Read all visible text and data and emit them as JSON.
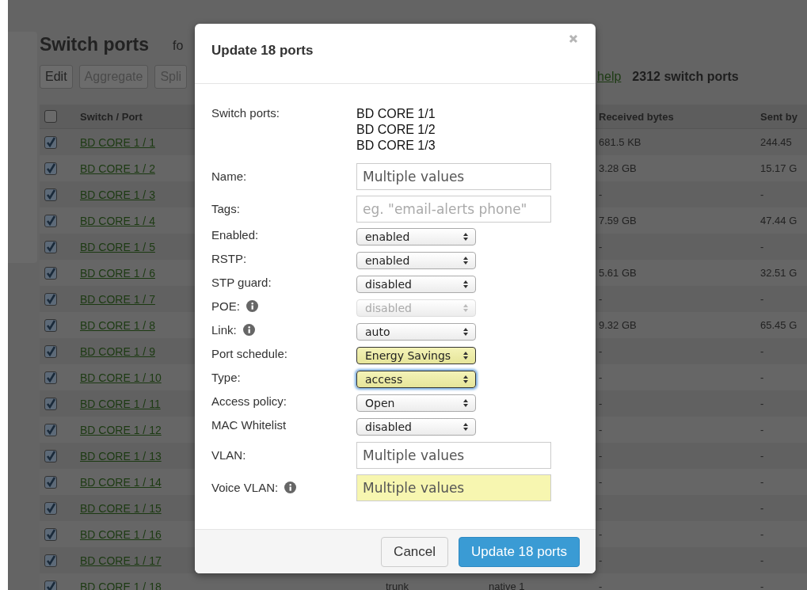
{
  "page": {
    "title": "Switch ports",
    "title_suffix": "fo",
    "help_link": "help",
    "count": "2312 switch ports",
    "toolbar": [
      {
        "label": "Edit",
        "disabled": false
      },
      {
        "label": "Aggregate",
        "disabled": true
      },
      {
        "label": "Spli",
        "disabled": true
      }
    ]
  },
  "table": {
    "select_all": {
      "checked": false
    },
    "columns": {
      "port": "Switch / Port",
      "received": "Received bytes",
      "sent": "Sent by"
    },
    "rows": [
      {
        "checked": true,
        "port": "BD CORE 1 / 1",
        "received": "681.5 KB",
        "sent": "244.45"
      },
      {
        "checked": true,
        "port": "BD CORE 1 / 2",
        "received": "3.28 GB",
        "sent": "15.17 G"
      },
      {
        "checked": true,
        "port": "BD CORE 1 / 3",
        "received": "-",
        "sent": "-"
      },
      {
        "checked": true,
        "port": "BD CORE 1 / 4",
        "received": "7.59 GB",
        "sent": "47.44 G"
      },
      {
        "checked": true,
        "port": "BD CORE 1 / 5",
        "received": "-",
        "sent": "-"
      },
      {
        "checked": true,
        "port": "BD CORE 1 / 6",
        "received": "5.61 GB",
        "sent": "32.51 G"
      },
      {
        "checked": true,
        "port": "BD CORE 1 / 7",
        "received": "-",
        "sent": "-"
      },
      {
        "checked": true,
        "port": "BD CORE 1 / 8",
        "received": "9.32 GB",
        "sent": "65.45 G"
      },
      {
        "checked": true,
        "port": "BD CORE 1 / 9",
        "received": "-",
        "sent": "-"
      },
      {
        "checked": true,
        "port": "BD CORE 1 / 10",
        "received": "-",
        "sent": "-"
      },
      {
        "checked": true,
        "port": "BD CORE 1 / 11",
        "received": "-",
        "sent": "-"
      },
      {
        "checked": true,
        "port": "BD CORE 1 / 12",
        "received": "-",
        "sent": "-"
      },
      {
        "checked": true,
        "port": "BD CORE 1 / 13",
        "received": "-",
        "sent": "-"
      },
      {
        "checked": true,
        "port": "BD CORE 1 / 14",
        "received": "-",
        "sent": "-"
      },
      {
        "checked": true,
        "port": "BD CORE 1 / 15",
        "received": "-",
        "sent": "-"
      },
      {
        "checked": true,
        "port": "BD CORE 1 / 16",
        "received": "-",
        "sent": "-"
      },
      {
        "checked": true,
        "port": "BD CORE 1 / 17",
        "received": "-",
        "sent": "-"
      },
      {
        "checked": true,
        "port": "BD CORE 1 / 18",
        "column_3": "trunk",
        "column_4": "native 1",
        "received": "-",
        "sent": "-"
      }
    ]
  },
  "dialog": {
    "title": "Update 18 ports",
    "switch_ports_label": "Switch ports:",
    "switch_ports": [
      "BD CORE 1/1",
      "BD CORE 1/2",
      "BD CORE 1/3"
    ],
    "fields": [
      {
        "label": "Name:",
        "kind": "text",
        "value": "Multiple values",
        "changed": false
      },
      {
        "label": "Tags:",
        "kind": "text",
        "placeholder": "eg. \"email-alerts phone\"",
        "changed": false
      },
      {
        "label": "Enabled:",
        "kind": "select",
        "value": "enabled",
        "changed": false,
        "disabled": false,
        "focused": false
      },
      {
        "label": "RSTP:",
        "kind": "select",
        "value": "enabled",
        "changed": false,
        "disabled": false,
        "focused": false
      },
      {
        "label": "STP guard:",
        "kind": "select",
        "value": "disabled",
        "changed": false,
        "disabled": false,
        "focused": false
      },
      {
        "label": "POE:",
        "kind": "select",
        "value": "disabled",
        "info": true,
        "changed": false,
        "disabled": true,
        "focused": false
      },
      {
        "label": "Link:",
        "kind": "select",
        "value": "auto",
        "info": true,
        "changed": false,
        "disabled": false,
        "focused": false
      },
      {
        "label": "Port schedule:",
        "kind": "select",
        "value": "Energy Savings",
        "changed": true,
        "disabled": false,
        "focused": false
      },
      {
        "label": "Type:",
        "kind": "select",
        "value": "access",
        "changed": true,
        "disabled": false,
        "focused": true
      },
      {
        "label": "Access policy:",
        "kind": "select",
        "value": "Open",
        "changed": false,
        "disabled": false,
        "focused": false
      },
      {
        "label": "MAC Whitelist",
        "kind": "select",
        "value": "disabled",
        "changed": false,
        "disabled": false,
        "focused": false
      },
      {
        "label": "VLAN:",
        "kind": "text",
        "value": "Multiple values",
        "changed": false
      },
      {
        "label": "Voice VLAN:",
        "kind": "text",
        "value": "Multiple values",
        "info": true,
        "changed": true
      }
    ],
    "buttons": [
      {
        "label": "Cancel",
        "kind": "secondary"
      },
      {
        "label": "Update 18 ports",
        "kind": "primary"
      }
    ]
  }
}
